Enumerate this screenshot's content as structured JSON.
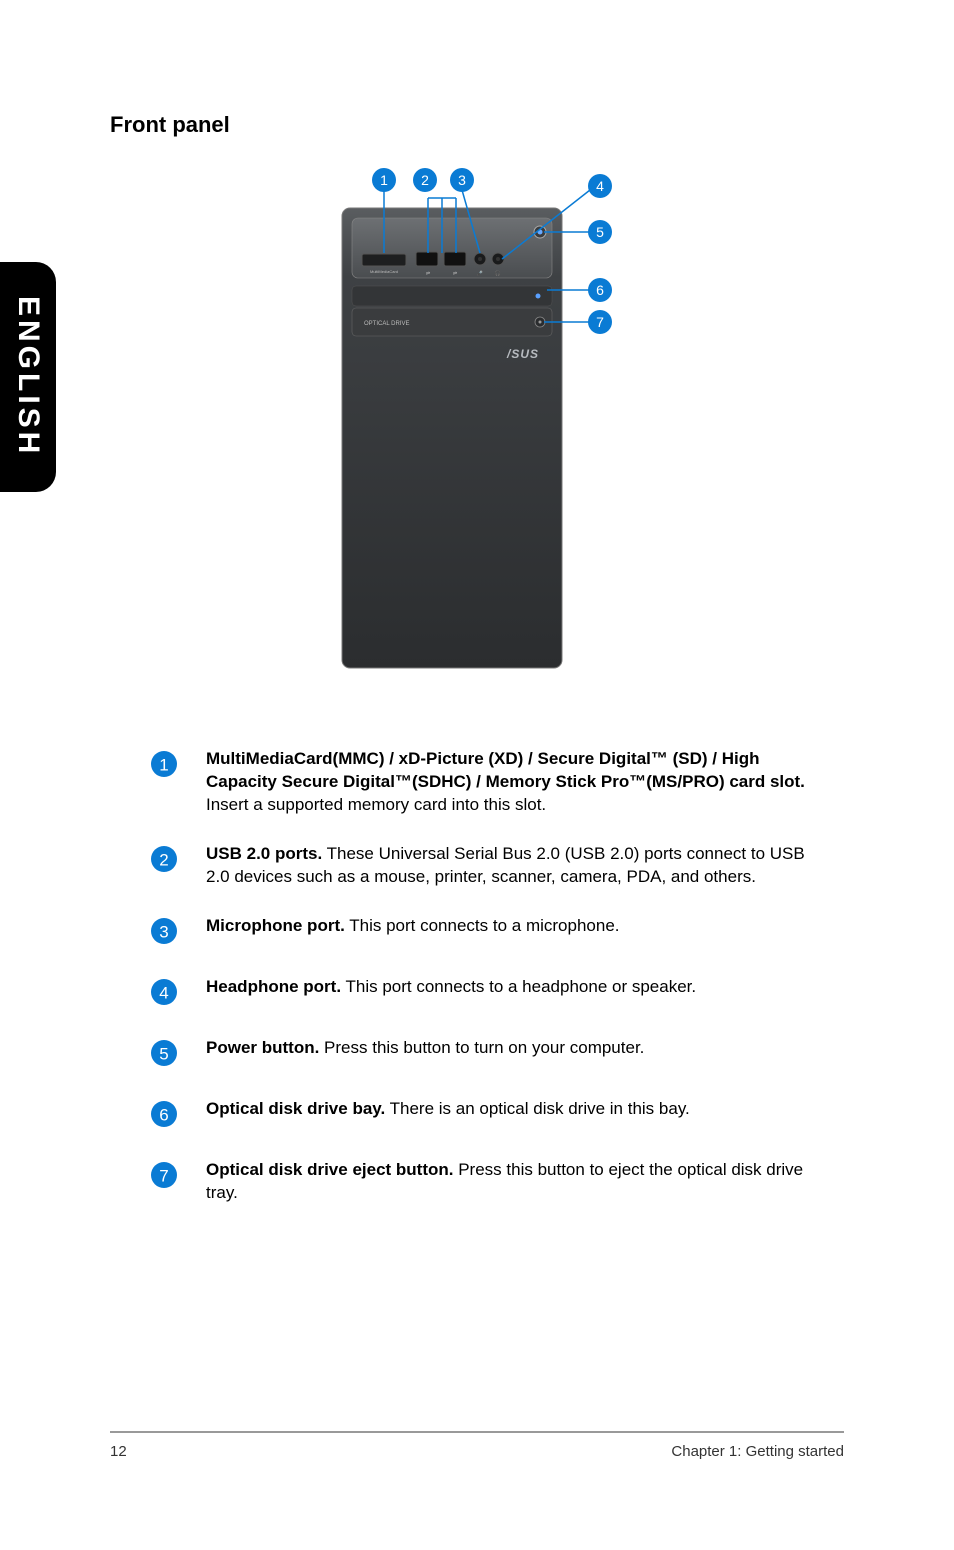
{
  "sidetab": "ENGLISH",
  "heading": "Front panel",
  "callouts": [
    "1",
    "2",
    "3",
    "4",
    "5",
    "6",
    "7"
  ],
  "items": [
    {
      "num": "1",
      "bold": "MultiMediaCard(MMC) / xD-Picture (XD) / Secure Digital™ (SD) / High Capacity Secure Digital™(SDHC) / Memory Stick Pro™(MS/PRO) card slot.",
      "rest": " Insert a supported memory card into this slot."
    },
    {
      "num": "2",
      "bold": "USB 2.0 ports.",
      "rest": " These Universal Serial Bus 2.0 (USB 2.0) ports connect to USB 2.0 devices such as a mouse, printer, scanner, camera, PDA, and others."
    },
    {
      "num": "3",
      "bold": "Microphone port.",
      "rest": " This port connects to a microphone."
    },
    {
      "num": "4",
      "bold": "Headphone port.",
      "rest": " This port connects to a headphone or speaker."
    },
    {
      "num": "5",
      "bold": "Power button.",
      "rest": " Press this button to turn on your computer."
    },
    {
      "num": "6",
      "bold": "Optical disk drive bay.",
      "rest": " There is an optical disk drive in this bay."
    },
    {
      "num": "7",
      "bold": "Optical disk drive eject button.",
      "rest": " Press this button to eject the optical disk drive tray."
    }
  ],
  "footer_left": "12",
  "footer_right": "Chapter 1: Getting started"
}
